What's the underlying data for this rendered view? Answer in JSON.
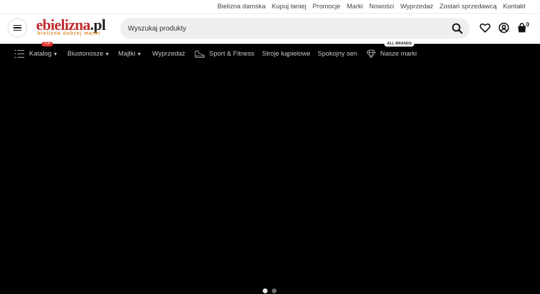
{
  "top_links": [
    "Bielizna damska",
    "Kupuj taniej",
    "Promocje",
    "Marki",
    "Nowości",
    "Wyprzedaż",
    "Zostań sprzedawcą",
    "Kontakt"
  ],
  "logo": {
    "main": "ebielizna",
    "suffix": ".pl",
    "tagline": "bielizna dobrej marki"
  },
  "search": {
    "placeholder": "Wyszukaj produkty"
  },
  "cart": {
    "count": "0"
  },
  "nav": {
    "catalog": "Katalog",
    "catalog_badge": "TOP",
    "bras": "Biustonosze",
    "panties": "Majtki",
    "sale": "Wyprzedaż",
    "sport": "Sport & Fitness",
    "swim": "Stroje kąpielowe",
    "sleep": "Spokojny sen",
    "brands": "Nasze marki",
    "brands_badge": "ALL BRANDS"
  },
  "slider": {
    "active_index": 0,
    "count": 2
  },
  "colors": {
    "brand_red": "#c02b2e",
    "accent_orange": "#e08c2c",
    "nav_bg": "#000000",
    "badge_red": "#e0322b"
  },
  "icons": [
    "menu-icon",
    "search-icon",
    "heart-icon",
    "user-icon",
    "bag-icon",
    "list-icon",
    "sneaker-icon",
    "diamond-icon"
  ]
}
